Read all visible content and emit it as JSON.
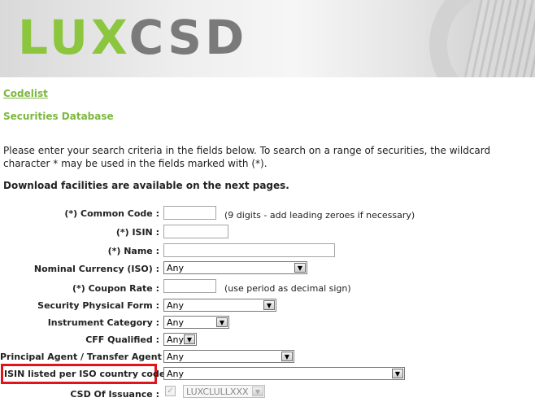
{
  "brand": {
    "lu": "LU",
    "x": "X",
    "csd": "CSD"
  },
  "nav": {
    "codelist_link": "Codelist"
  },
  "page": {
    "title": "Securities Database",
    "intro": "Please enter your search criteria in the fields below. To search on a range of securities, the wildcard character * may be used in the fields marked with (*).",
    "download_note": "Download facilities are available on the next pages."
  },
  "form": {
    "common_code": {
      "label": "(*) Common Code :",
      "value": "",
      "hint": "(9 digits - add leading zeroes if necessary)"
    },
    "isin": {
      "label": "(*) ISIN :",
      "value": ""
    },
    "name": {
      "label": "(*) Name :",
      "value": ""
    },
    "nominal_currency": {
      "label": "Nominal Currency (ISO) :",
      "value": "Any"
    },
    "coupon_rate": {
      "label": "(*) Coupon Rate :",
      "value": "",
      "hint": "(use period as decimal sign)"
    },
    "physical_form": {
      "label": "Security Physical Form :",
      "value": "Any"
    },
    "instrument_category": {
      "label": "Instrument Category :",
      "value": "Any"
    },
    "cff_qualified": {
      "label": "CFF Qualified :",
      "value": "Any"
    },
    "principal_agent": {
      "label": "Principal Agent / Transfer Agent :",
      "value": "Any"
    },
    "isin_country": {
      "label": "ISIN listed per ISO country code:",
      "value": "Any"
    },
    "csd_issuance": {
      "label": "CSD Of Issuance :",
      "value": "LUXCLULLXXX",
      "checked": true
    }
  },
  "colors": {
    "accent": "#7cb83f",
    "highlight": "#e0151b"
  }
}
